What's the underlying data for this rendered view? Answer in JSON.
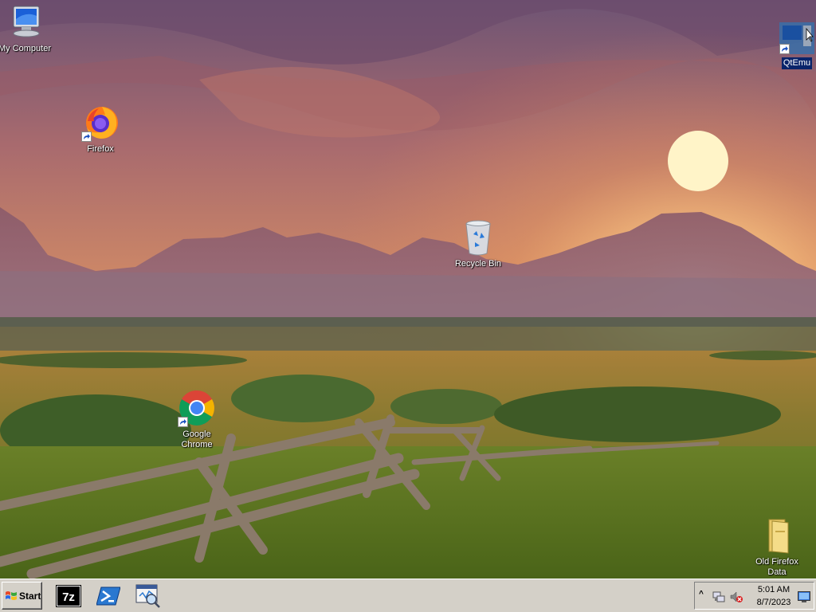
{
  "desktop": {
    "icons": {
      "my_computer": {
        "label": "My Computer",
        "icon": "computer-icon"
      },
      "firefox": {
        "label": "Firefox",
        "icon": "firefox-icon"
      },
      "recycle_bin": {
        "label": "Recycle Bin",
        "icon": "recycle-bin-icon"
      },
      "chrome": {
        "label_line1": "Google",
        "label_line2": "Chrome",
        "icon": "chrome-icon"
      },
      "qtemu": {
        "label": "QtEmu",
        "icon": "qtemu-icon"
      },
      "old_firefox_data": {
        "label_line1": "Old Firefox",
        "label_line2": "Data",
        "icon": "folder-icon"
      }
    }
  },
  "taskbar": {
    "start_label": "Start",
    "quick_launch": [
      "7zip-icon",
      "powershell-icon",
      "search-window-icon"
    ],
    "tray": {
      "time": "5:01 AM",
      "date": "8/7/2023",
      "icons": [
        "chevron-up-icon",
        "network-icon",
        "volume-muted-icon",
        "show-desktop-icon"
      ]
    }
  },
  "colors": {
    "taskbar_bg": "#d4d0c8",
    "selection": "#0a246a",
    "sky_top": "#7a5a78",
    "sky_glow": "#f0a860"
  }
}
